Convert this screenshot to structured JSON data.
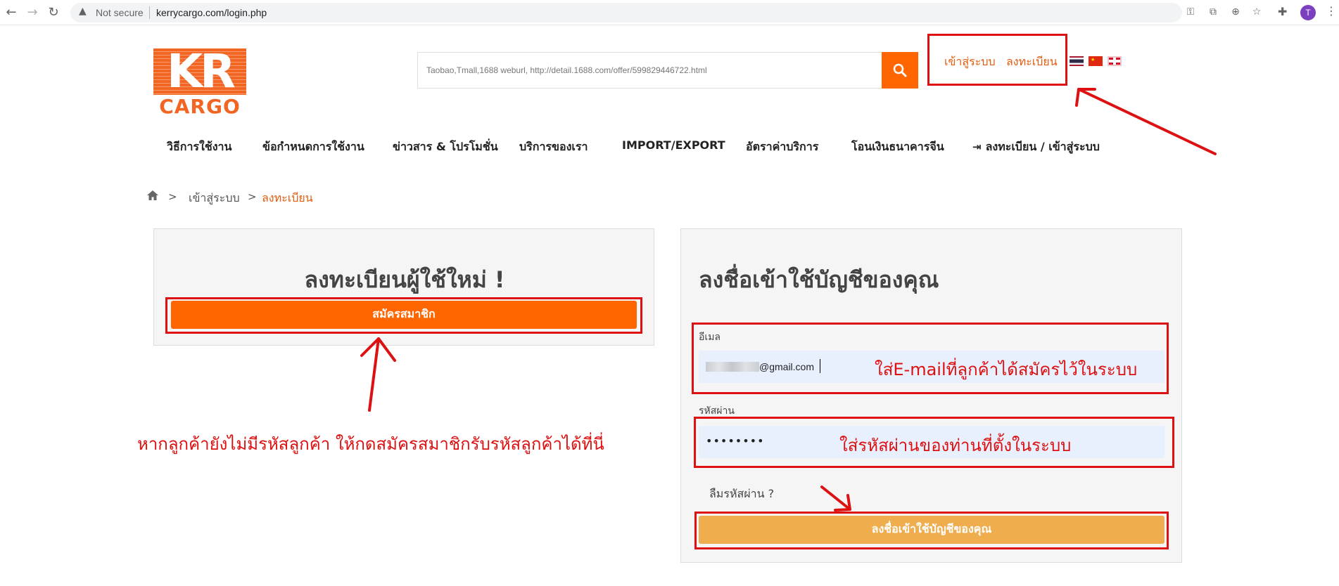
{
  "browser": {
    "not_secure": "Not secure",
    "url": "kerrycargo.com/login.php"
  },
  "logo": {
    "top": "KR",
    "bottom": "CARGO"
  },
  "search": {
    "placeholder": "Taobao,Tmall,1688 weburl, http://detail.1688.com/offer/599829446722.html"
  },
  "top_links": {
    "login": "เข้าสู่ระบบ",
    "register": "ลงทะเบียน"
  },
  "menu": [
    "วิธีการใช้งาน",
    "ข้อกำหนดการใช้งาน",
    "ข่าวสาร & โปรโมชั่น",
    "บริการของเรา",
    "IMPORT/EXPORT",
    "อัตราค่าบริการ",
    "โอนเงินธนาคารจีน",
    "ลงทะเบียน / เข้าสู่ระบบ"
  ],
  "breadcrumb": {
    "sep": ">",
    "login": "เข้าสู่ระบบ",
    "current": "ลงทะเบียน"
  },
  "register_panel": {
    "title": "ลงทะเบียนผู้ใช้ใหม่ !",
    "button": "สมัครสมาชิก"
  },
  "login_panel": {
    "title": "ลงชื่อเข้าใช้บัญชีของคุณ",
    "email_label": "อีเมล",
    "email_value": "@gmail.com",
    "password_label": "รหัสผ่าน",
    "password_value": "••••••••",
    "forgot": "ลืมรหัสผ่าน ?",
    "button": "ลงชื่อเข้าใช้บัญชีของคุณ"
  },
  "annotations": {
    "email_hint": "ใส่E-mailที่ลูกค้าได้สมัครไว้ในระบบ",
    "password_hint": "ใส่รหัสผ่านของท่านที่ตั้งในระบบ",
    "register_hint": "หากลูกค้ายังไม่มีรหัสลูกค้า ให้กดสมัครสมาชิกรับรหัสลูกค้าได้ที่นี่"
  },
  "colors": {
    "accent_orange": "#ff6600",
    "login_button": "#f0ad4e",
    "annotation_red": "#dd1111"
  }
}
